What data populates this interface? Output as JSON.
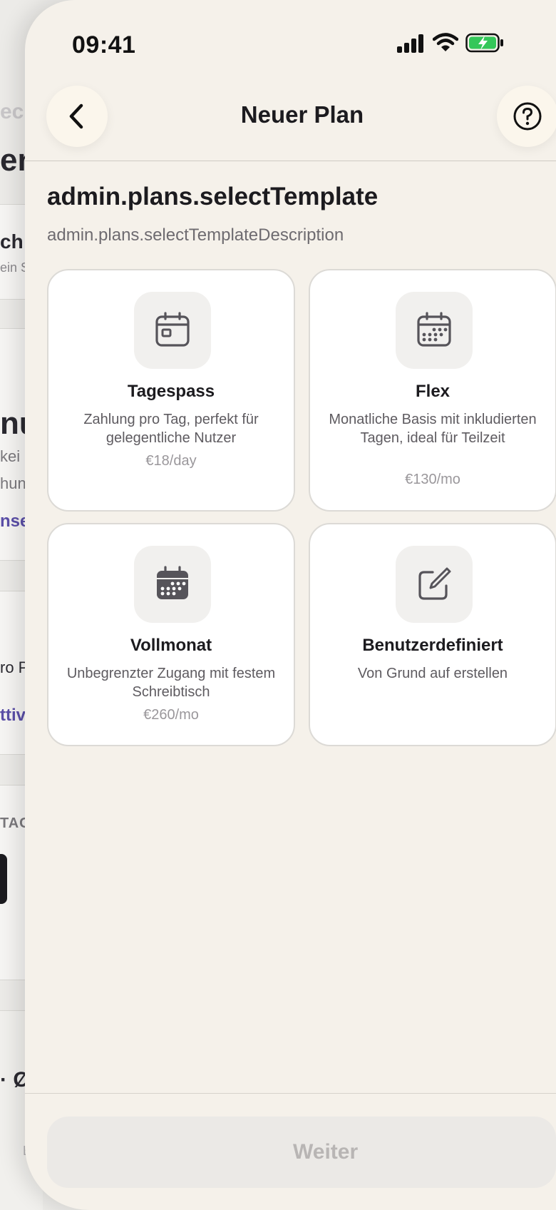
{
  "background": {
    "fragments": [
      "ch",
      "ein S",
      "nu",
      "kei",
      "hun",
      "nse",
      "ro P",
      "ttiv",
      "TAG",
      "· Ø",
      "E"
    ]
  },
  "status_bar": {
    "time": "09:41"
  },
  "header": {
    "title": "Neuer Plan"
  },
  "section": {
    "title": "admin.plans.selectTemplate",
    "description": "admin.plans.selectTemplateDescription"
  },
  "templates": [
    {
      "title": "Tagespass",
      "description": "Zahlung pro Tag, perfekt für gelegentliche Nutzer",
      "price": "€18/day",
      "icon": "calendar-day-icon"
    },
    {
      "title": "Flex",
      "description": "Monatliche Basis mit inkludierten Tagen, ideal für Teilzeit",
      "price": "€130/mo",
      "icon": "calendar-dots-icon"
    },
    {
      "title": "Vollmonat",
      "description": "Unbegrenzter Zugang mit festem Schreibtisch",
      "price": "€260/mo",
      "icon": "calendar-filled-icon"
    },
    {
      "title": "Benutzerdefiniert",
      "description": "Von Grund auf erstellen",
      "price": "",
      "icon": "edit-square-icon"
    }
  ],
  "footer": {
    "next_label": "Weiter",
    "next_disabled": true
  },
  "colors": {
    "sheet_background": "#f5f1ea",
    "card_background": "#ffffff",
    "accent_purple": "#5b4fa8",
    "battery_green": "#34c759"
  }
}
